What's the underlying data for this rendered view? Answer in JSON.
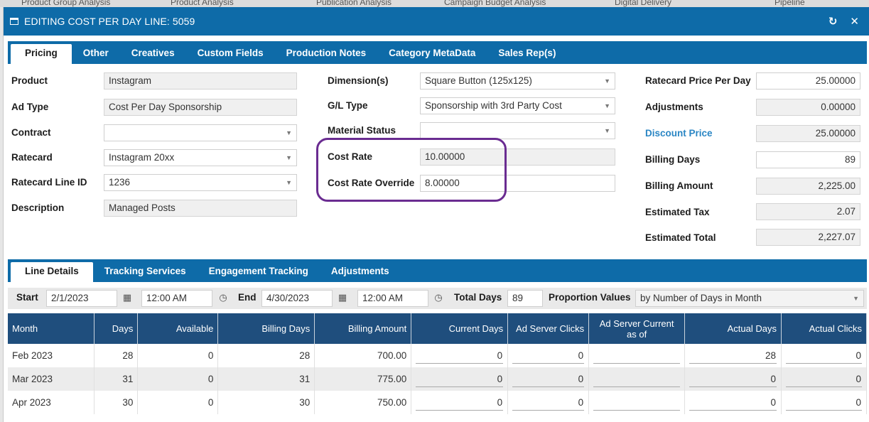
{
  "background_tabs": [
    "Product Group Analysis",
    "Product Analysis",
    "Publication Analysis",
    "Campaign Budget Analysis",
    "Digital Delivery",
    "Pipeline"
  ],
  "window": {
    "title": "EDITING COST PER DAY LINE: 5059",
    "refresh_icon": "refresh-icon",
    "close_icon": "close-icon"
  },
  "top_tabs": [
    "Pricing",
    "Other",
    "Creatives",
    "Custom Fields",
    "Production Notes",
    "Category MetaData",
    "Sales Rep(s)"
  ],
  "pricing": {
    "product_label": "Product",
    "product_value": "Instagram",
    "ad_type_label": "Ad Type",
    "ad_type_value": "Cost Per Day Sponsorship",
    "contract_label": "Contract",
    "contract_value": "",
    "ratecard_label": "Ratecard",
    "ratecard_value": "Instagram 20xx",
    "ratecard_line_label": "Ratecard Line ID",
    "ratecard_line_value": "1236",
    "description_label": "Description",
    "description_value": "Managed Posts",
    "dimensions_label": "Dimension(s)",
    "dimensions_value": "Square Button (125x125)",
    "gl_type_label": "G/L Type",
    "gl_type_value": "Sponsorship with 3rd Party Cost",
    "material_status_label": "Material Status",
    "material_status_value": "",
    "cost_rate_label": "Cost Rate",
    "cost_rate_value": "10.00000",
    "cost_rate_override_label": "Cost Rate Override",
    "cost_rate_override_value": "8.00000",
    "ratecard_price_label": "Ratecard Price Per Day",
    "ratecard_price_value": "25.00000",
    "adjustments_label": "Adjustments",
    "adjustments_value": "0.00000",
    "discount_price_label": "Discount Price",
    "discount_price_value": "25.00000",
    "billing_days_label": "Billing Days",
    "billing_days_value": "89",
    "billing_amount_label": "Billing Amount",
    "billing_amount_value": "2,225.00",
    "estimated_tax_label": "Estimated Tax",
    "estimated_tax_value": "2.07",
    "estimated_total_label": "Estimated Total",
    "estimated_total_value": "2,227.07"
  },
  "bottom_tabs": [
    "Line Details",
    "Tracking Services",
    "Engagement Tracking",
    "Adjustments"
  ],
  "line_details": {
    "start_label": "Start",
    "start_date": "2/1/2023",
    "start_time": "12:00 AM",
    "end_label": "End",
    "end_date": "4/30/2023",
    "end_time": "12:00 AM",
    "total_days_label": "Total Days",
    "total_days_value": "89",
    "proportion_label": "Proportion Values",
    "proportion_value": "by Number of Days in Month",
    "columns": [
      "Month",
      "Days",
      "Available",
      "Billing Days",
      "Billing Amount",
      "Current Days",
      "Ad Server Clicks",
      "Ad Server Current as of",
      "Actual Days",
      "Actual Clicks"
    ],
    "rows": [
      {
        "month": "Feb 2023",
        "days": "28",
        "available": "0",
        "billing_days": "28",
        "billing_amount": "700.00",
        "current_days": "0",
        "ad_server_clicks": "0",
        "ad_server_current": "",
        "actual_days": "28",
        "actual_clicks": "0"
      },
      {
        "month": "Mar 2023",
        "days": "31",
        "available": "0",
        "billing_days": "31",
        "billing_amount": "775.00",
        "current_days": "0",
        "ad_server_clicks": "0",
        "ad_server_current": "",
        "actual_days": "0",
        "actual_clicks": "0"
      },
      {
        "month": "Apr 2023",
        "days": "30",
        "available": "0",
        "billing_days": "30",
        "billing_amount": "750.00",
        "current_days": "0",
        "ad_server_clicks": "0",
        "ad_server_current": "",
        "actual_days": "0",
        "actual_clicks": "0"
      }
    ]
  },
  "colors": {
    "header_blue": "#0e6ba8",
    "grid_header": "#1f4e7d",
    "highlight_purple": "#6a2c91",
    "link_blue": "#2a86c4"
  }
}
